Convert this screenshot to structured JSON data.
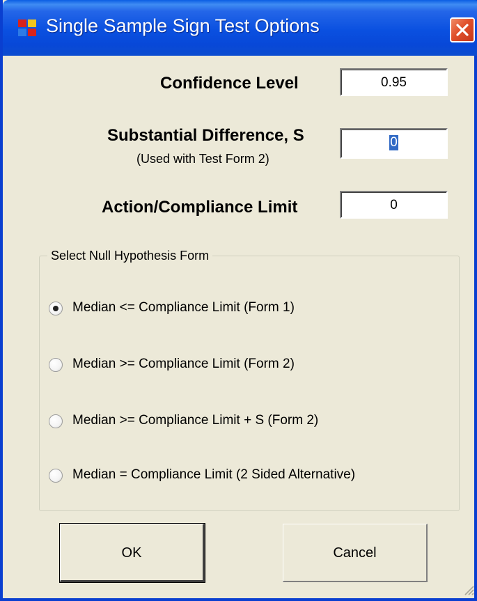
{
  "window": {
    "title": "Single Sample Sign Test Options",
    "accent_color": "#0a50e0",
    "close_icon": "close-icon"
  },
  "fields": {
    "confidence_level": {
      "label": "Confidence Level",
      "value": "0.95"
    },
    "substantial_difference": {
      "label": "Substantial Difference, S",
      "note": "(Used with Test Form 2)",
      "value": "0"
    },
    "action_limit": {
      "label": "Action/Compliance Limit",
      "value": "0"
    }
  },
  "null_hypothesis": {
    "legend": "Select Null Hypothesis Form",
    "options": [
      {
        "label": "Median <= Compliance Limit (Form 1)",
        "selected": true
      },
      {
        "label": "Median >= Compliance Limit  (Form 2)",
        "selected": false
      },
      {
        "label": "Median >= Compliance Limit + S  (Form 2)",
        "selected": false
      },
      {
        "label": "Median = Compliance Limit (2 Sided Alternative)",
        "selected": false
      }
    ]
  },
  "buttons": {
    "ok": "OK",
    "cancel": "Cancel"
  }
}
